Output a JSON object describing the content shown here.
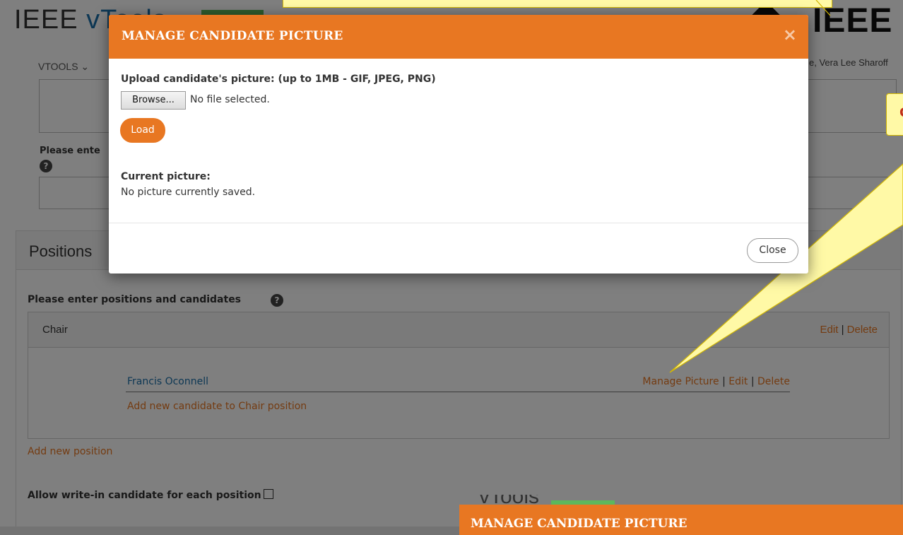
{
  "background": {
    "logo_prefix": "IEEE ",
    "logo_v": "vTools",
    "ieee_brand": "IEEE",
    "nav_vtools": "VTOOLS ⌄",
    "user_name": "e, Vera Lee Sharoff",
    "please_enter_label": "Please ente",
    "help_glyph": "?",
    "positions_title": "Positions",
    "positions_label": "Please enter positions and candidates",
    "chair": {
      "name": "Chair",
      "edit": "Edit",
      "separator": "|",
      "delete": "Delete"
    },
    "candidate": {
      "name": "Francis Oconnell",
      "manage_picture": "Manage Picture",
      "separator": "|",
      "edit": "Edit",
      "delete": "Delete"
    },
    "add_candidate": "Add new candidate to Chair position",
    "add_position": "Add new position",
    "allow_write_in": "Allow write-in candidate for each position"
  },
  "modal": {
    "title": "MANAGE CANDIDATE PICTURE",
    "close_x": "×",
    "upload_label": "Upload candidate's picture: (up to 1MB - GIF, JPEG, PNG)",
    "browse_label": "Browse...",
    "file_status": "No file selected.",
    "load_label": "Load",
    "current_label": "Current picture:",
    "current_status": "No picture currently saved.",
    "close_label": "Close"
  },
  "callout": {
    "partial_text": "C"
  },
  "inset": {
    "logo": "vTools",
    "title": "MANAGE CANDIDATE PICTURE"
  },
  "colors": {
    "accent_orange": "#e87722",
    "link_blue": "#1b6fa8",
    "callout_yellow": "#fff9a6",
    "badge_green": "#5cb85c"
  }
}
